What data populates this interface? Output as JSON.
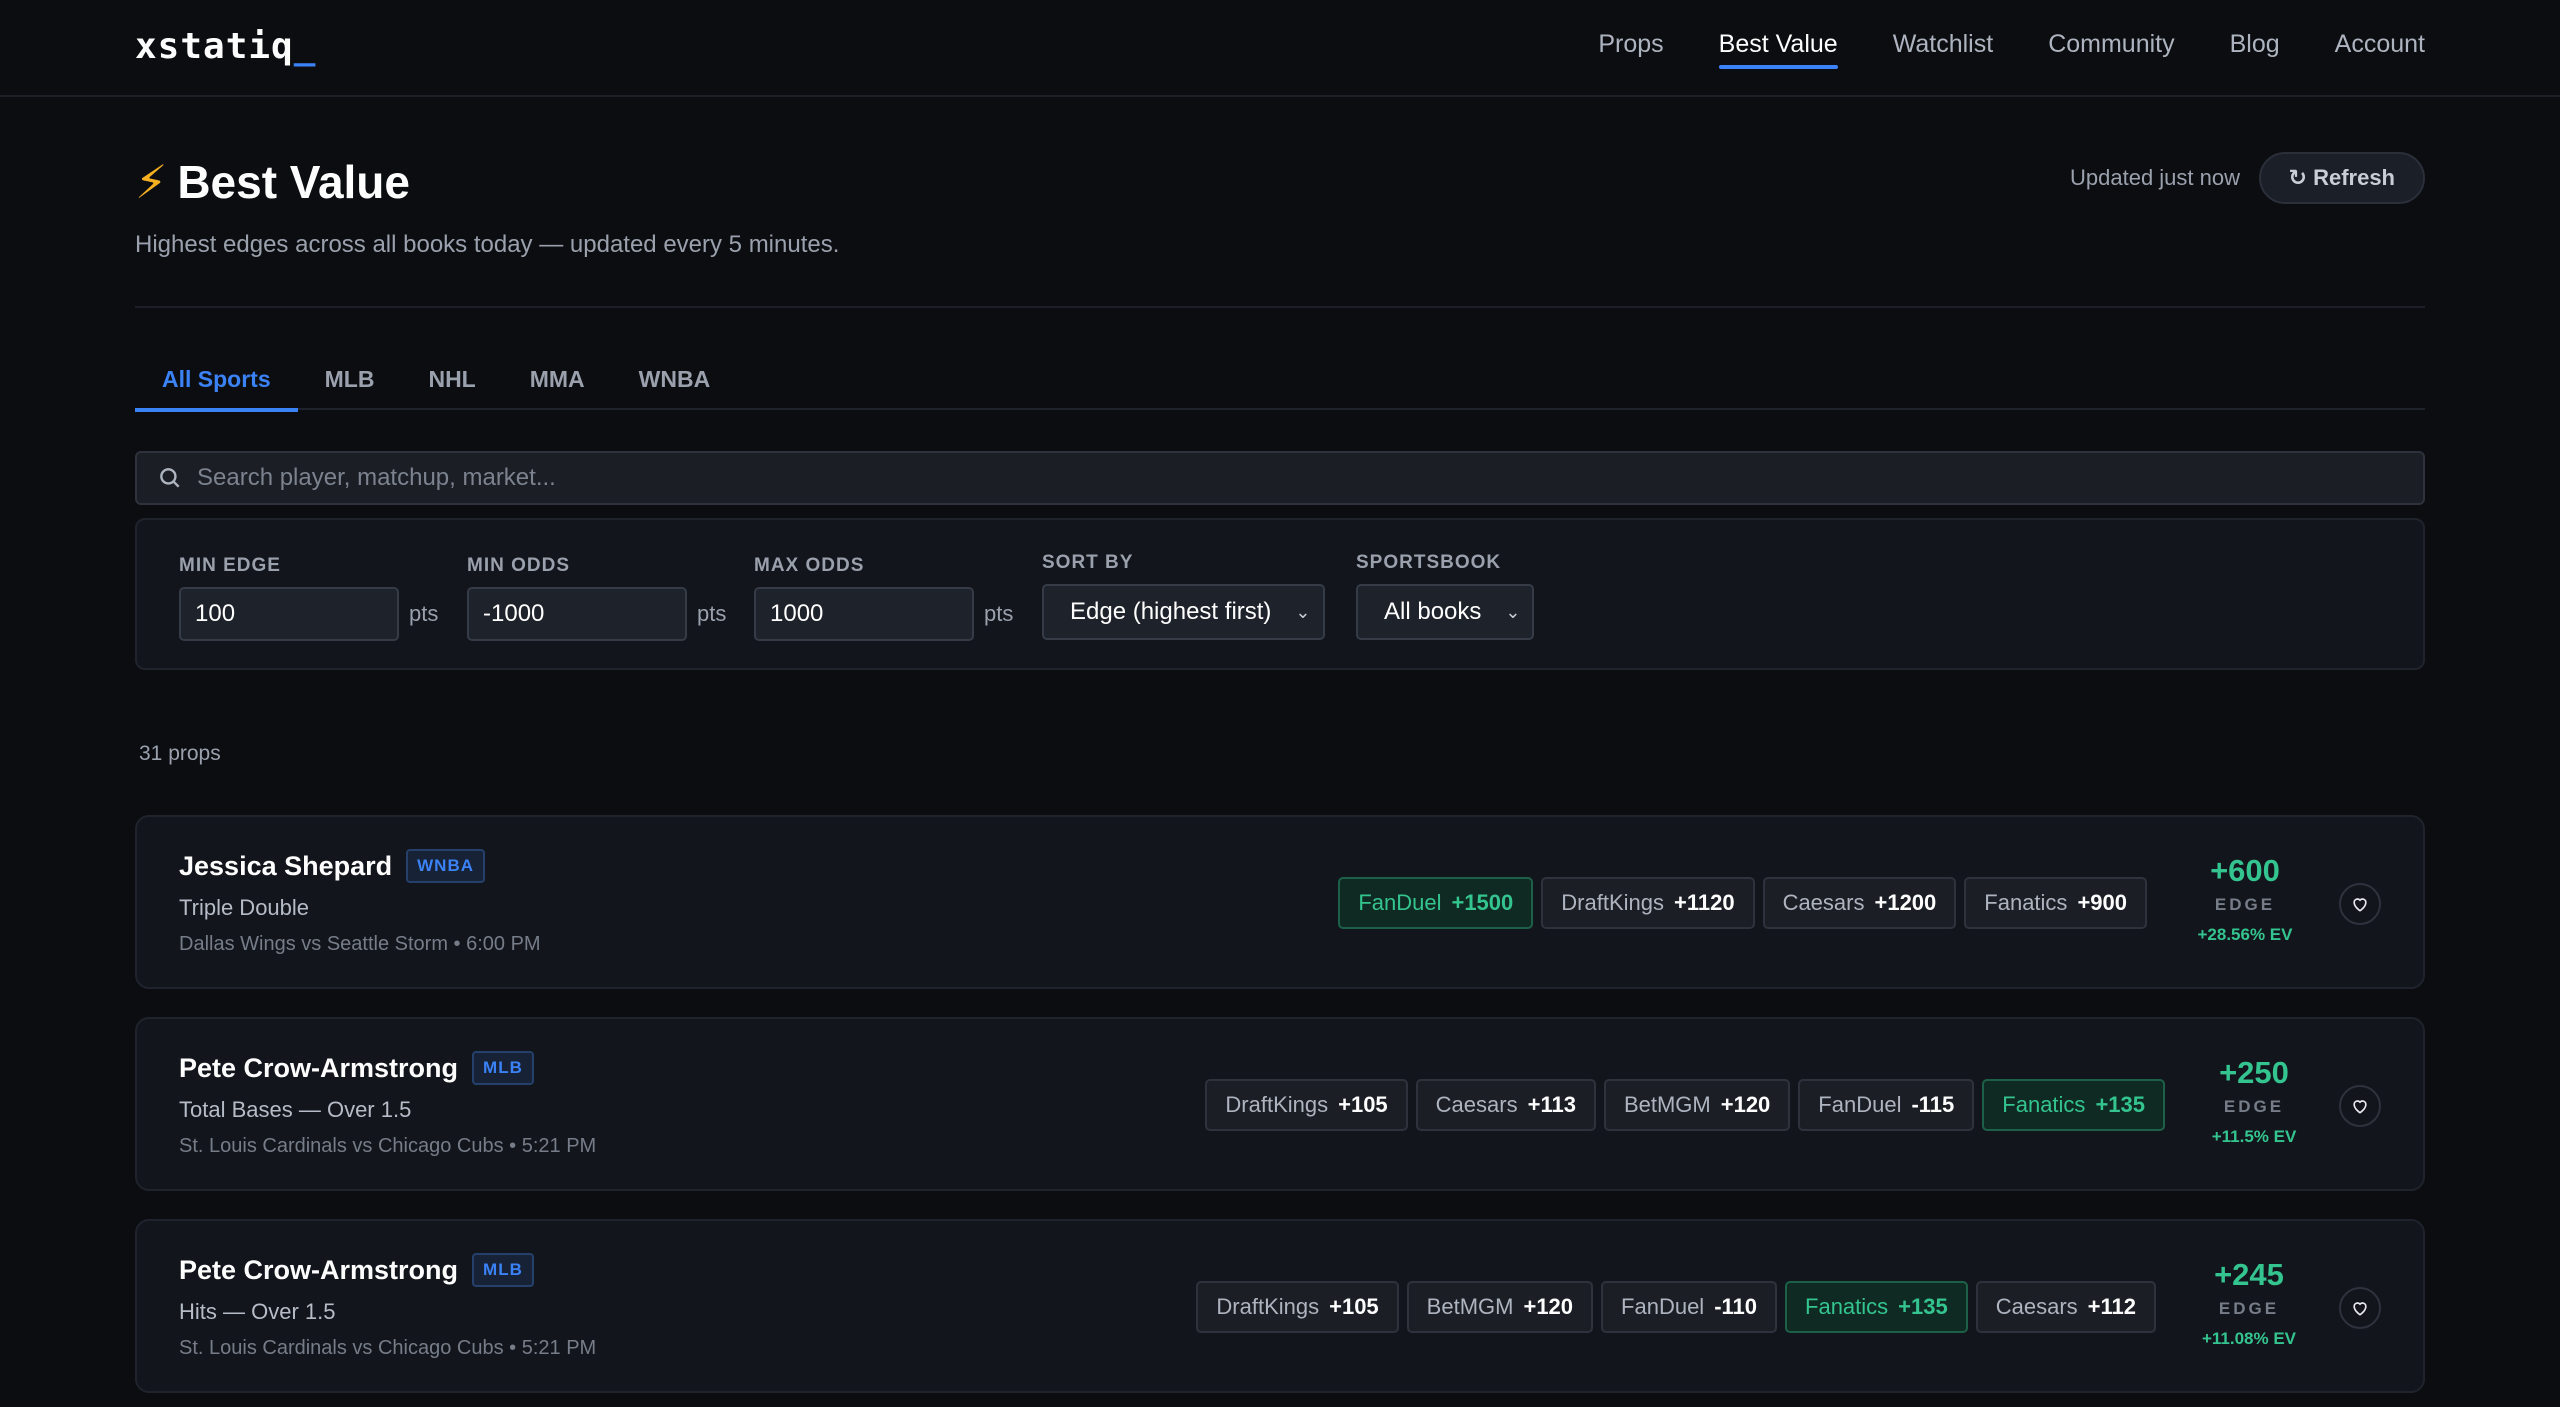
{
  "app": {
    "logo": "xstatiq",
    "logo_cursor": "_",
    "nav": [
      "Props",
      "Best Value",
      "Watchlist",
      "Community",
      "Blog",
      "Account"
    ],
    "nav_active": "Best Value"
  },
  "header": {
    "icon": "lightning-icon",
    "title": "Best Value",
    "subtitle": "Highest edges across all books today — updated every 5 minutes.",
    "updated": "Updated just now",
    "refresh_label": "↻ Refresh"
  },
  "tabs": [
    "All Sports",
    "MLB",
    "NHL",
    "MMA",
    "WNBA"
  ],
  "active_tab": "All Sports",
  "search": {
    "placeholder": "Search player, matchup, market...",
    "value": ""
  },
  "filters": {
    "min_edge": {
      "label": "MIN EDGE",
      "value": "100",
      "unit": "pts"
    },
    "min_odds": {
      "label": "MIN ODDS",
      "value": "-1000",
      "unit": "pts"
    },
    "max_odds": {
      "label": "MAX ODDS",
      "value": "1000",
      "unit": "pts"
    },
    "sort_by": {
      "label": "SORT BY",
      "value": "Edge (highest first)"
    },
    "sportsbook": {
      "label": "SPORTSBOOK",
      "value": "All books"
    }
  },
  "count": "31 props",
  "edge_label": "EDGE",
  "colors": {
    "accent": "#3b82f6",
    "positive": "#34c48f",
    "background": "#0b0d11",
    "bolt": "#f5b021"
  },
  "props": [
    {
      "player": "Jessica Shepard",
      "league": "WNBA",
      "market": "Triple Double",
      "game": "Dallas Wings vs Seattle Storm • 6:00 PM",
      "books": [
        {
          "name": "FanDuel",
          "odds": "+1500",
          "best": true
        },
        {
          "name": "DraftKings",
          "odds": "+1120",
          "best": false
        },
        {
          "name": "Caesars",
          "odds": "+1200",
          "best": false
        },
        {
          "name": "Fanatics",
          "odds": "+900",
          "best": false
        }
      ],
      "edge": "+600",
      "ev": "+28.56% EV"
    },
    {
      "player": "Pete Crow-Armstrong",
      "league": "MLB",
      "market": "Total Bases — Over 1.5",
      "game": "St. Louis Cardinals vs Chicago Cubs • 5:21 PM",
      "books": [
        {
          "name": "DraftKings",
          "odds": "+105",
          "best": false
        },
        {
          "name": "Caesars",
          "odds": "+113",
          "best": false
        },
        {
          "name": "BetMGM",
          "odds": "+120",
          "best": false
        },
        {
          "name": "FanDuel",
          "odds": "-115",
          "best": false
        },
        {
          "name": "Fanatics",
          "odds": "+135",
          "best": true
        }
      ],
      "edge": "+250",
      "ev": "+11.5% EV"
    },
    {
      "player": "Pete Crow-Armstrong",
      "league": "MLB",
      "market": "Hits — Over 1.5",
      "game": "St. Louis Cardinals vs Chicago Cubs • 5:21 PM",
      "books": [
        {
          "name": "DraftKings",
          "odds": "+105",
          "best": false
        },
        {
          "name": "BetMGM",
          "odds": "+120",
          "best": false
        },
        {
          "name": "FanDuel",
          "odds": "-110",
          "best": false
        },
        {
          "name": "Fanatics",
          "odds": "+135",
          "best": true
        },
        {
          "name": "Caesars",
          "odds": "+112",
          "best": false
        }
      ],
      "edge": "+245",
      "ev": "+11.08% EV"
    }
  ]
}
